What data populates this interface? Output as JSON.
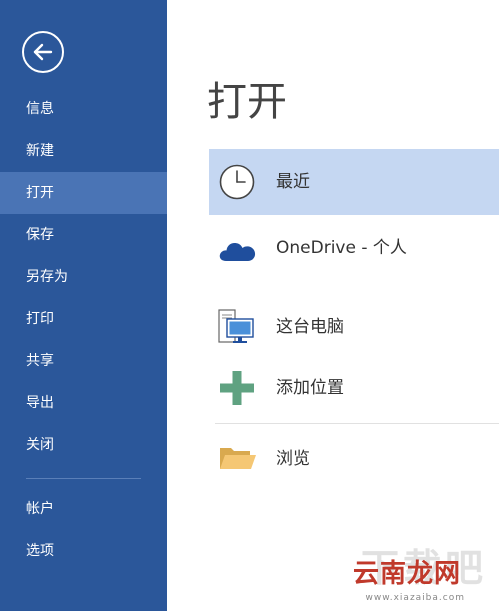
{
  "sidebar": {
    "background": "#2b579a",
    "selected_background": "#4a74b5",
    "back_icon": "arrow-left-circle-icon",
    "items": [
      {
        "label": "信息"
      },
      {
        "label": "新建"
      },
      {
        "label": "打开",
        "selected": true
      },
      {
        "label": "保存"
      },
      {
        "label": "另存为"
      },
      {
        "label": "打印"
      },
      {
        "label": "共享"
      },
      {
        "label": "导出"
      },
      {
        "label": "关闭"
      },
      {
        "label": "帐户"
      },
      {
        "label": "选项"
      }
    ]
  },
  "main": {
    "title": "打开",
    "selected_background": "#c5d7f2",
    "locations": [
      {
        "label": "最近",
        "icon": "clock-icon",
        "selected": true
      },
      {
        "label": "OneDrive - 个人",
        "icon": "cloud-icon"
      },
      {
        "label": "这台电脑",
        "icon": "computer-icon"
      },
      {
        "label": "添加位置",
        "icon": "plus-icon"
      },
      {
        "label": "浏览",
        "icon": "folder-icon"
      }
    ]
  },
  "watermark": {
    "text": "下载吧",
    "brand": "云南龙网",
    "url": "www.xiazaiba.com"
  }
}
